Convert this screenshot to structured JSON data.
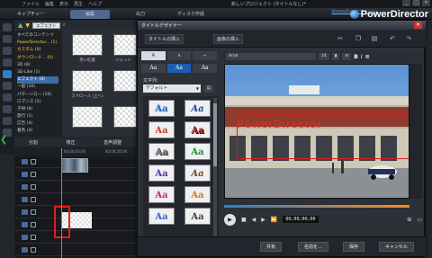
{
  "menu": [
    "ファイル",
    "編集",
    "表示",
    "再生",
    "ヘルプ"
  ],
  "window_title": "新しいプロジェクト (タイトルなし)*",
  "modes": [
    "キャプチャー",
    "編集",
    "出力",
    "ディスク作成"
  ],
  "app_name": "PowerDirector",
  "directorzone": "DirectorZone にサインイン",
  "library": {
    "filter_label": "エフェクト",
    "tree": [
      {
        "label": "すべてのコンテンツ",
        "state": "normal"
      },
      {
        "label": "PowerDirector... (1)",
        "state": "hi"
      },
      {
        "label": "カスタム (0)",
        "state": "hi"
      },
      {
        "label": "ダウンロード... (0)",
        "state": "hi"
      },
      {
        "label": "3D (8)",
        "state": "normal"
      },
      {
        "label": "3D-Like (1)",
        "state": "normal"
      },
      {
        "label": "エフェクト (8)",
        "state": "sel"
      },
      {
        "label": "一般 (16)",
        "state": "normal"
      },
      {
        "label": "パターンロー (10)",
        "state": "normal"
      },
      {
        "label": "ロマンス (3)",
        "state": "normal"
      },
      {
        "label": "子供 (8)",
        "state": "normal"
      },
      {
        "label": "旅行 (1)",
        "state": "normal"
      },
      {
        "label": "広告 (4)",
        "state": "normal"
      },
      {
        "label": "着色 (4)",
        "state": "normal"
      }
    ],
    "thumbs": [
      "赤い紅葉",
      "ジェット",
      "スクロール (上へ)",
      ""
    ]
  },
  "edit_buttons": [
    "分割",
    "修正",
    "音声調整"
  ],
  "timeline_ruler": [
    "00;00;00;00",
    "00;00;20;00"
  ],
  "dialog": {
    "title": "タイトルデザイナー",
    "close": "✕",
    "insert_title": "タイトルの挿入",
    "insert_image": "画像の挿入",
    "left_tabs": [
      "A",
      "ʌ",
      "⌐"
    ],
    "style_tabs": [
      "Aa",
      "Aa",
      "Aa"
    ],
    "style_label": "文字列:",
    "style_value": "デフォルト",
    "font_name": "Arial",
    "font_size": "24",
    "swatches": [
      "Aa",
      "Aa",
      "Aa",
      "Aa",
      "Aa",
      "Aa",
      "Aa",
      "Aa",
      "Aa",
      "Aa",
      "Aa",
      "Aa"
    ],
    "timecode": "00;00;00;00",
    "buttons": [
      "共有",
      "名前を...",
      "保存",
      "キャンセル"
    ],
    "preview_title": "PowerDirector"
  },
  "colors": {
    "accent": "#2f7fc8",
    "highlight": "#ffd23a",
    "title_text": "#d8302a"
  }
}
